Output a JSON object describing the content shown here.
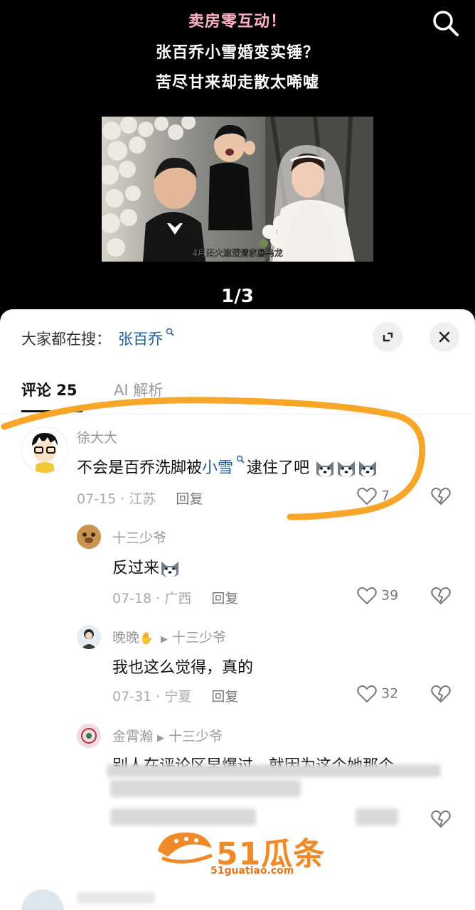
{
  "video": {
    "headline_1": "卖房零互动！",
    "headline_2": "张百乔小雪婚变实锤？",
    "headline_3": "苦尽甘来却走散太唏嘘",
    "photo_caption": "4月还火速澄清家暴乌龙",
    "pager": "1/3",
    "search_icon": "search-icon"
  },
  "sheet": {
    "trend_label": "大家都在搜：",
    "trend_keyword": "张百乔",
    "expand_icon": "expand-icon",
    "close_icon": "close-icon",
    "tabs": [
      {
        "label": "评论 25",
        "active": true
      },
      {
        "label": "AI 解析",
        "active": false
      }
    ]
  },
  "comments": [
    {
      "user": "徐大大",
      "text_before": "不会是百乔洗脚被",
      "link": "小雪",
      "text_after": "逮住了吧",
      "date": "07-15 · 江苏",
      "reply": "回复",
      "likes": "7"
    },
    {
      "user": "十三少爷",
      "text": "反过来",
      "date": "07-18 · 广西",
      "reply": "回复",
      "likes": "39"
    },
    {
      "user": "晚晚",
      "reply_to": "十三少爷",
      "text": "我也这么觉得，真的",
      "date": "07-31 · 宁夏",
      "reply": "回复",
      "likes": "32"
    },
    {
      "user": "金霄瀚",
      "reply_to": "十三少爷",
      "text": "别人在评论区早爆过，就因为这个她那个"
    }
  ],
  "watermark": {
    "brand": "51瓜条",
    "url": "51guatiao.com"
  },
  "colors": {
    "accent_link": "#1f5e9c",
    "headline_pink": "#ffb3c7",
    "annotation_orange": "#f7a62a",
    "watermark_orange": "#f08a28"
  }
}
